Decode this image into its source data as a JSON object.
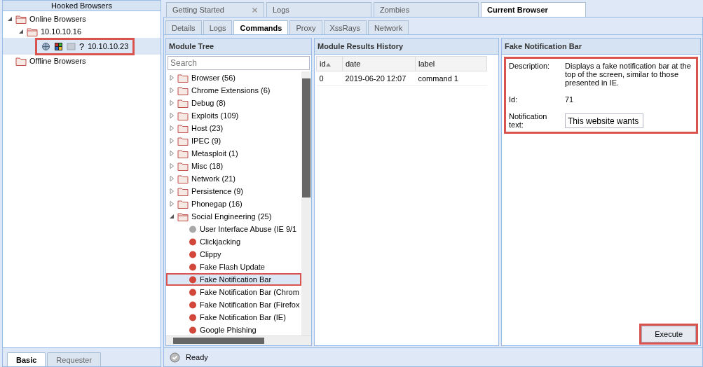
{
  "hooked_browsers": {
    "title": "Hooked Browsers",
    "tree": [
      {
        "label": "Online Browsers",
        "expanded": true,
        "children": [
          {
            "label": "10.10.10.16",
            "expanded": true,
            "children": [
              {
                "kind": "browser",
                "label": "10.10.10.23",
                "unknown_mark": "?",
                "selected": true,
                "highlighted": true
              }
            ]
          }
        ]
      },
      {
        "label": "Offline Browsers",
        "expanded": false
      }
    ]
  },
  "left_tabs": [
    {
      "label": "Basic",
      "selected": true
    },
    {
      "label": "Requester",
      "selected": false
    }
  ],
  "main_tabs": [
    {
      "label": "Getting Started",
      "closable": true,
      "selected": false
    },
    {
      "label": "Logs",
      "closable": false,
      "selected": false
    },
    {
      "label": "Zombies",
      "closable": false,
      "selected": false
    },
    {
      "label": "Current Browser",
      "closable": false,
      "selected": true
    }
  ],
  "sub_tabs": [
    {
      "label": "Details",
      "selected": false
    },
    {
      "label": "Logs",
      "selected": false
    },
    {
      "label": "Commands",
      "selected": true
    },
    {
      "label": "Proxy",
      "selected": false
    },
    {
      "label": "XssRays",
      "selected": false
    },
    {
      "label": "Network",
      "selected": false
    }
  ],
  "module_tree": {
    "title": "Module Tree",
    "search": {
      "placeholder": "Search"
    },
    "items": [
      {
        "label": "Browser (56)",
        "expanded": false
      },
      {
        "label": "Chrome Extensions (6)",
        "expanded": false
      },
      {
        "label": "Debug (8)",
        "expanded": false
      },
      {
        "label": "Exploits (109)",
        "expanded": false
      },
      {
        "label": "Host (23)",
        "expanded": false
      },
      {
        "label": "IPEC (9)",
        "expanded": false
      },
      {
        "label": "Metasploit (1)",
        "expanded": false
      },
      {
        "label": "Misc (18)",
        "expanded": false
      },
      {
        "label": "Network (21)",
        "expanded": false
      },
      {
        "label": "Persistence (9)",
        "expanded": false
      },
      {
        "label": "Phonegap (16)",
        "expanded": false
      },
      {
        "label": "Social Engineering (25)",
        "expanded": true,
        "children": [
          {
            "label": "User Interface Abuse (IE 9/1",
            "color": "#a8a8a8",
            "selected": false,
            "highlighted": false
          },
          {
            "label": "Clickjacking",
            "color": "#d2473a",
            "selected": false,
            "highlighted": false
          },
          {
            "label": "Clippy",
            "color": "#d2473a",
            "selected": false,
            "highlighted": false
          },
          {
            "label": "Fake Flash Update",
            "color": "#d2473a",
            "selected": false,
            "highlighted": false
          },
          {
            "label": "Fake Notification Bar",
            "color": "#d2473a",
            "selected": true,
            "highlighted": true
          },
          {
            "label": "Fake Notification Bar (Chrom",
            "color": "#d2473a",
            "selected": false,
            "highlighted": false
          },
          {
            "label": "Fake Notification Bar (Firefox",
            "color": "#d2473a",
            "selected": false,
            "highlighted": false
          },
          {
            "label": "Fake Notification Bar (IE)",
            "color": "#d2473a",
            "selected": false,
            "highlighted": false
          },
          {
            "label": "Google Phishing",
            "color": "#d2473a",
            "selected": false,
            "highlighted": false
          }
        ]
      }
    ]
  },
  "results": {
    "title": "Module Results History",
    "columns": [
      {
        "label": "id",
        "sorted": true
      },
      {
        "label": "date",
        "sorted": false
      },
      {
        "label": "label",
        "sorted": false
      }
    ],
    "rows": [
      [
        "0",
        "2019-06-20 12:07",
        "command 1"
      ]
    ]
  },
  "details": {
    "title": "Fake Notification Bar",
    "highlighted": true,
    "fields": [
      {
        "kind": "text",
        "label": "Description:",
        "value": "Displays a fake notification bar at the top of the screen, similar to those presented in IE."
      },
      {
        "kind": "text",
        "label": "Id:",
        "value": "71"
      },
      {
        "kind": "input",
        "label": "Notification text:",
        "value": "This website wants"
      }
    ],
    "execute": {
      "label": "Execute",
      "highlighted": true
    }
  },
  "status_bar": {
    "text": "Ready"
  }
}
